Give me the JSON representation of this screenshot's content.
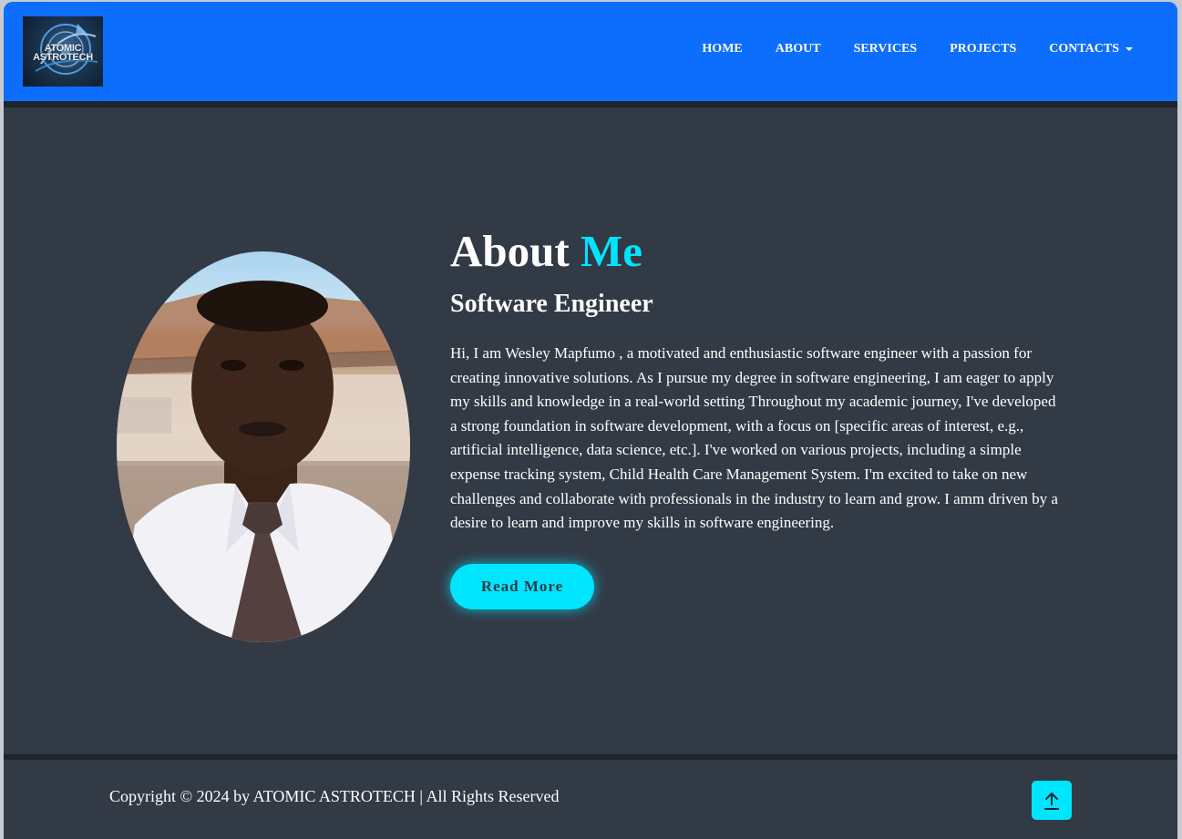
{
  "header": {
    "logo": {
      "line1": "ATOMIC",
      "line2": "ASTROTECH",
      "icon": "atomic-astrotech-logo"
    },
    "nav": [
      {
        "label": "HOME"
      },
      {
        "label": "ABOUT"
      },
      {
        "label": "SERVICES"
      },
      {
        "label": "PROJECTS"
      },
      {
        "label": "CONTACTS",
        "dropdown": true
      }
    ],
    "color": "#0d6efd"
  },
  "about": {
    "title_main": "About",
    "title_accent": "Me",
    "subtitle": "Software Engineer",
    "bio": "Hi, I am Wesley Mapfumo , a motivated and enthusiastic software engineer with a passion for creating innovative solutions. As I pursue my degree in software engineering, I am eager to apply my skills and knowledge in a real-world setting Throughout my academic journey, I've developed a strong foundation in software development, with a focus on [specific areas of interest, e.g., artificial intelligence, data science, etc.]. I've worked on various projects, including a simple expense tracking system, Child Health Care Management System. I'm excited to take on new challenges and collaborate with professionals in the industry to learn and grow. I amm driven by a desire to learn and improve my skills in software engineering.",
    "button_label": "Read More",
    "accent_color": "#00e5ff",
    "photo_icon": "profile-photo"
  },
  "footer": {
    "copyright": "Copyright © 2024 by ATOMIC ASTROTECH | All Rights Reserved",
    "to_top_icon": "arrow-up-icon"
  },
  "colors": {
    "background": "#323a46",
    "text": "#ffffff"
  }
}
